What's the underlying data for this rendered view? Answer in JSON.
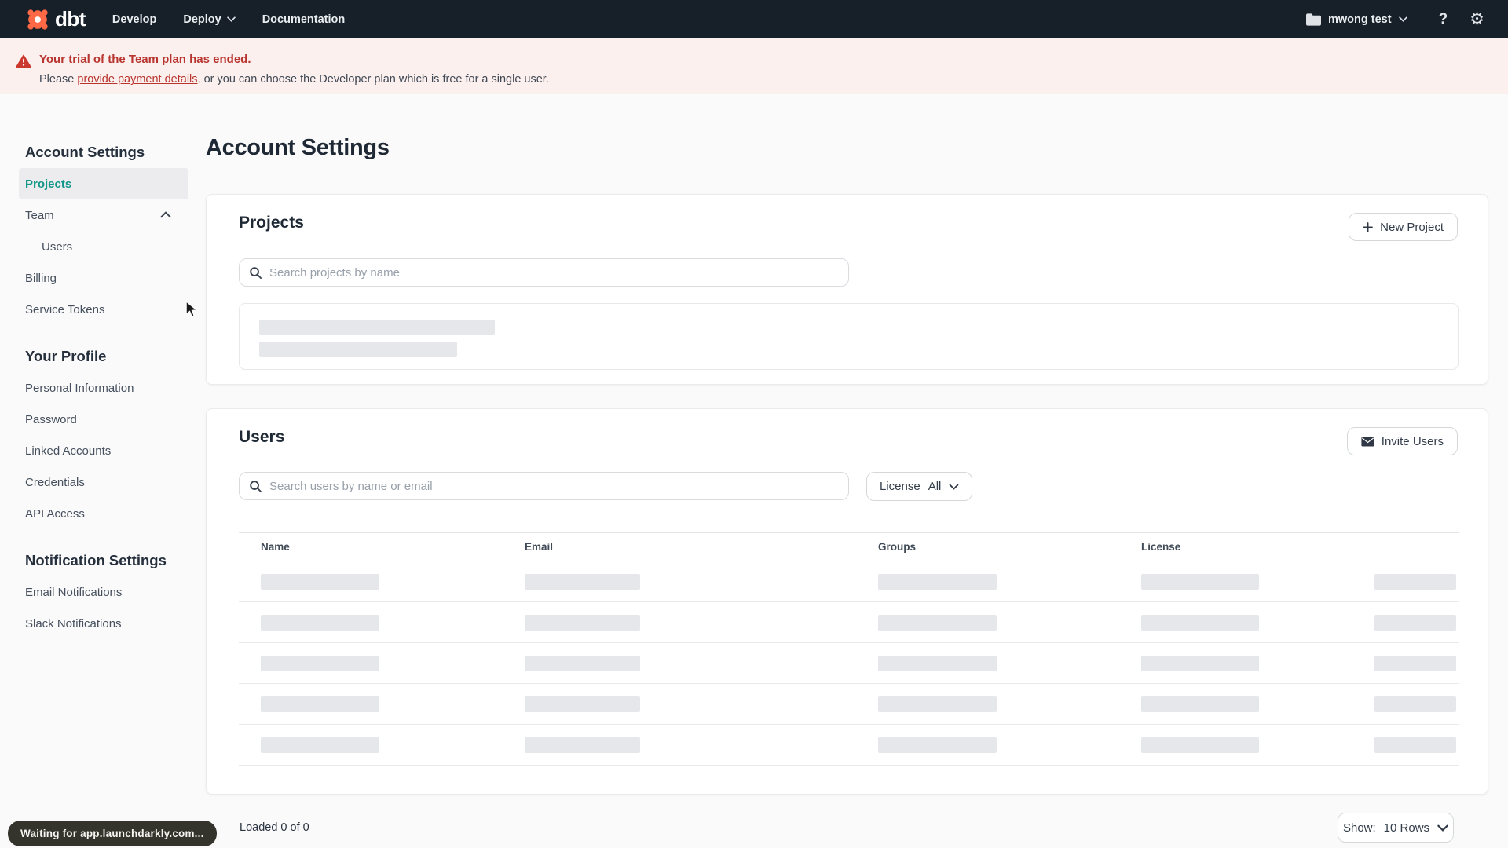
{
  "topnav": {
    "brand": "dbt",
    "items": [
      {
        "label": "Develop"
      },
      {
        "label": "Deploy"
      },
      {
        "label": "Documentation"
      }
    ],
    "account_label": "mwong test",
    "help_label": "?",
    "gear_glyph": "⚙"
  },
  "banner": {
    "title": "Your trial of the Team plan has ended.",
    "body_prefix": "Please ",
    "link_text": "provide payment details",
    "body_suffix": ", or you can choose the Developer plan which is free for a single user."
  },
  "sidebar": {
    "sections": [
      {
        "heading": "Account Settings",
        "items": [
          {
            "label": "Projects"
          },
          {
            "label": "Team"
          },
          {
            "label": "Users"
          },
          {
            "label": "Billing"
          },
          {
            "label": "Service Tokens"
          }
        ]
      },
      {
        "heading": "Your Profile",
        "items": [
          {
            "label": "Personal Information"
          },
          {
            "label": "Password"
          },
          {
            "label": "Linked Accounts"
          },
          {
            "label": "Credentials"
          },
          {
            "label": "API Access"
          }
        ]
      },
      {
        "heading": "Notification Settings",
        "items": [
          {
            "label": "Email Notifications"
          },
          {
            "label": "Slack Notifications"
          }
        ]
      }
    ]
  },
  "main": {
    "title": "Account Settings",
    "projects_card": {
      "heading": "Projects",
      "button_label": "New Project",
      "search_placeholder": "Search projects by name"
    },
    "users_card": {
      "heading": "Users",
      "button_label": "Invite Users",
      "search_placeholder": "Search users by name or email",
      "license_filter_label": "License",
      "license_filter_value": "All",
      "table_headers": [
        "Name",
        "Email",
        "Groups",
        "License"
      ],
      "skeleton_row_count": "5"
    },
    "footer": {
      "loaded_text": "Loaded 0 of 0",
      "show_label": "Show:",
      "show_value": "10 Rows"
    }
  },
  "status_tooltip": {
    "text": "Waiting for app.launchdarkly.com..."
  },
  "colors": {
    "topnav_bg": "#172029",
    "brand_orange": "#ff6945",
    "banner_bg": "#fcf0ee",
    "alert_red": "#b8342e",
    "accent_teal": "#12968a",
    "skeleton_gray": "#e5e7ea"
  }
}
